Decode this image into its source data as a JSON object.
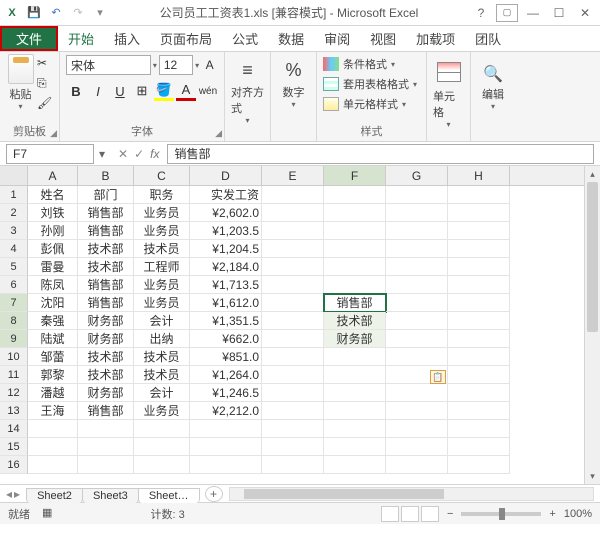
{
  "title": {
    "filename": "公司员工工资表1.xls",
    "mode": "[兼容模式]",
    "app": "Microsoft Excel"
  },
  "menu": {
    "file": "文件",
    "items": [
      "开始",
      "插入",
      "页面布局",
      "公式",
      "数据",
      "审阅",
      "视图",
      "加载项",
      "团队"
    ]
  },
  "ribbon": {
    "clipboard": {
      "paste": "粘贴",
      "group": "剪贴板"
    },
    "font": {
      "name": "宋体",
      "size": "12",
      "group": "字体",
      "bold": "B",
      "italic": "I",
      "underline": "U",
      "color_a": "A"
    },
    "align": {
      "label": "对齐方式"
    },
    "number": {
      "label": "数字",
      "percent": "%"
    },
    "styles": {
      "cond": "条件格式",
      "table": "套用表格格式",
      "cell": "单元格样式",
      "group": "样式"
    },
    "cells": {
      "label": "单元格"
    },
    "editing": {
      "label": "编辑"
    }
  },
  "namebox": "F7",
  "formula": "销售部",
  "columns": [
    "A",
    "B",
    "C",
    "D",
    "E",
    "F",
    "G",
    "H"
  ],
  "rows": [
    {
      "n": 1,
      "a": "姓名",
      "b": "部门",
      "c": "职务",
      "d": "实发工资"
    },
    {
      "n": 2,
      "a": "刘铁",
      "b": "销售部",
      "c": "业务员",
      "d": "¥2,602.0"
    },
    {
      "n": 3,
      "a": "孙刚",
      "b": "销售部",
      "c": "业务员",
      "d": "¥1,203.5"
    },
    {
      "n": 4,
      "a": "彭佩",
      "b": "技术部",
      "c": "技术员",
      "d": "¥1,204.5"
    },
    {
      "n": 5,
      "a": "雷曼",
      "b": "技术部",
      "c": "工程师",
      "d": "¥2,184.0"
    },
    {
      "n": 6,
      "a": "陈凤",
      "b": "销售部",
      "c": "业务员",
      "d": "¥1,713.5"
    },
    {
      "n": 7,
      "a": "沈阳",
      "b": "销售部",
      "c": "业务员",
      "d": "¥1,612.0",
      "f": "销售部"
    },
    {
      "n": 8,
      "a": "秦强",
      "b": "财务部",
      "c": "会计",
      "d": "¥1,351.5",
      "f": "技术部"
    },
    {
      "n": 9,
      "a": "陆斌",
      "b": "财务部",
      "c": "出纳",
      "d": "¥662.0",
      "f": "财务部"
    },
    {
      "n": 10,
      "a": "邹蕾",
      "b": "技术部",
      "c": "技术员",
      "d": "¥851.0"
    },
    {
      "n": 11,
      "a": "郭黎",
      "b": "技术部",
      "c": "技术员",
      "d": "¥1,264.0"
    },
    {
      "n": 12,
      "a": "潘越",
      "b": "财务部",
      "c": "会计",
      "d": "¥1,246.5"
    },
    {
      "n": 13,
      "a": "王海",
      "b": "销售部",
      "c": "业务员",
      "d": "¥2,212.0"
    },
    {
      "n": 14
    },
    {
      "n": 15
    },
    {
      "n": 16
    }
  ],
  "sheets": {
    "tabs": [
      "Sheet2",
      "Sheet3",
      "Sheet…"
    ],
    "active": 2
  },
  "status": {
    "mode": "就绪",
    "count_label": "计数:",
    "count": "3",
    "zoom": "100%"
  }
}
